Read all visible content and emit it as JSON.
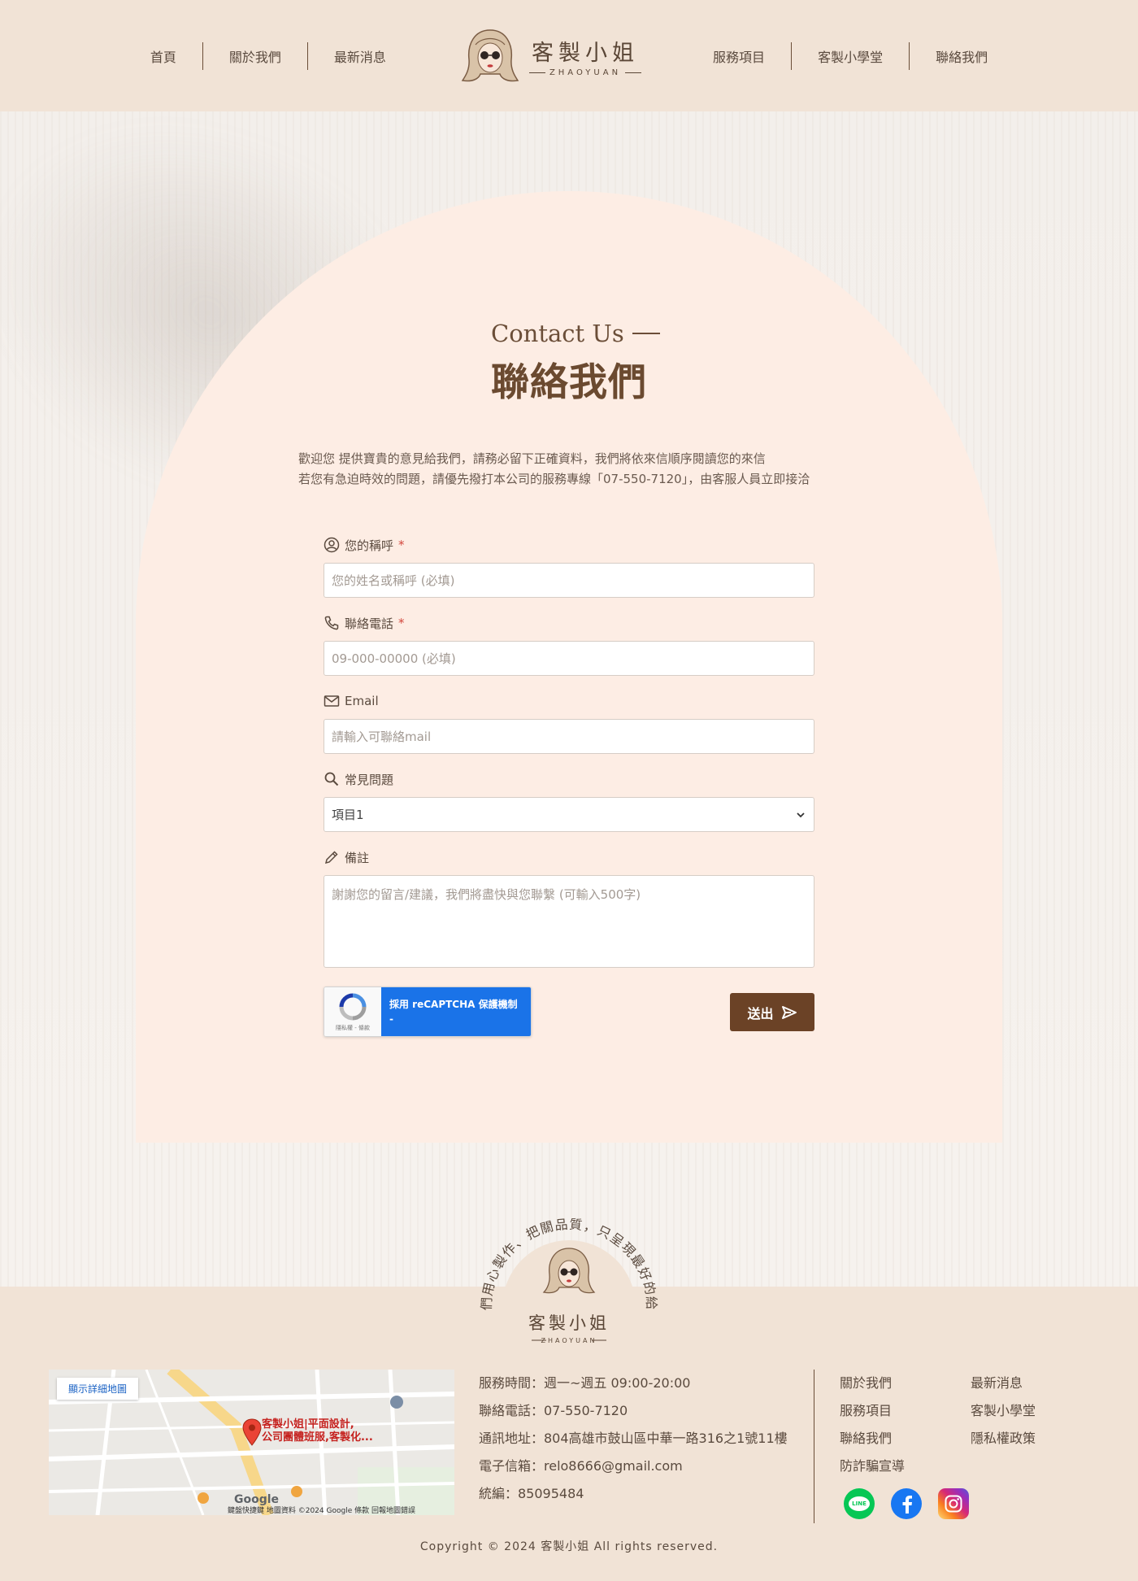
{
  "nav": {
    "left": [
      "首頁",
      "關於我們",
      "最新消息"
    ],
    "right": [
      "服務項目",
      "客製小學堂",
      "聯絡我們"
    ]
  },
  "logo": {
    "name": "客製小姐",
    "sub": "ZHAOYUAN"
  },
  "hero": {
    "title_en": "Contact Us",
    "title_zh": "聯絡我們",
    "intro_line1": "歡迎您 提供寶貴的意見給我們，請務必留下正確資料，我們將依來信順序閱讀您的來信",
    "intro_line2": "若您有急迫時效的問題，請優先撥打本公司的服務專線「07-550-7120」，由客服人員立即接洽"
  },
  "form": {
    "name_label": "您的稱呼",
    "name_placeholder": "您的姓名或稱呼 (必填)",
    "phone_label": "聯絡電話",
    "phone_placeholder": "09-000-00000 (必填)",
    "email_label": "Email",
    "email_placeholder": "請輸入可聯絡mail",
    "faq_label": "常見問題",
    "faq_selected": "項目1",
    "note_label": "備註",
    "note_placeholder": "謝謝您的留言/建議，我們將盡快與您聯繫 (可輸入500字)",
    "required_mark": "*",
    "recaptcha_text": "採用 reCAPTCHA 保護機制",
    "recaptcha_dash": "-",
    "recaptcha_small": "隱私權 - 條款",
    "submit_label": "送出"
  },
  "badge": {
    "arc_text": "我們用心製作、把關品質，只呈現最好的給你",
    "name": "客製小姐",
    "sub": "ZHAOYUAN"
  },
  "map": {
    "button": "顯示詳細地圖",
    "place_line1": "客製小姐|平面設計,",
    "place_line2": "公司團體班服,客製化...",
    "google": "Google",
    "attribution": "鍵盤快捷鍵 地圖資料 ©2024 Google 條款 回報地圖錯誤"
  },
  "info": {
    "hours": "服務時間：週一~週五 09:00-20:00",
    "phone": "聯絡電話：07-550-7120",
    "address": "通訊地址：804高雄市鼓山區中華一路316之1號11樓",
    "email": "電子信箱：relo8666@gmail.com",
    "tax_id": "統編：85095484"
  },
  "footer_links": [
    "關於我們",
    "最新消息",
    "服務項目",
    "客製小學堂",
    "聯絡我們",
    "隱私權政策",
    "防詐騙宣導"
  ],
  "socials": {
    "line": "LINE"
  },
  "copyright": "Copyright © 2024 客製小姐 All rights reserved.",
  "colors": {
    "brand_brown": "#6b4226",
    "header_bg": "#f1e3d6",
    "arch_bg": "#fdede4",
    "line_green": "#06c755",
    "facebook_blue": "#1877f2"
  }
}
